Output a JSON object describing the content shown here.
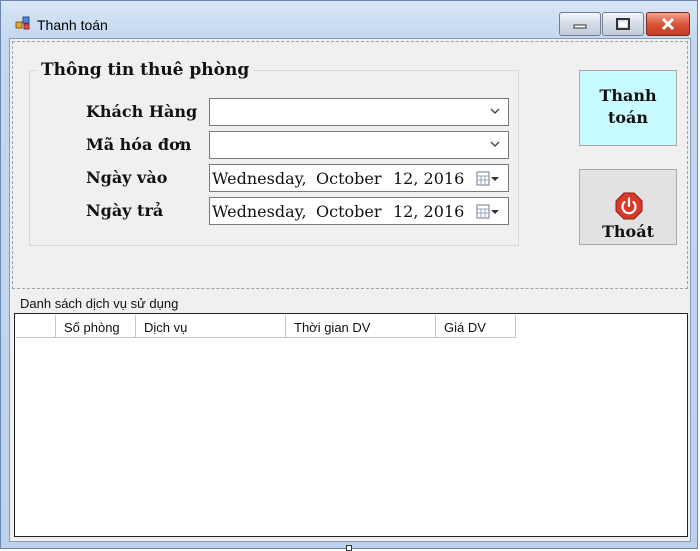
{
  "window": {
    "title": "Thanh toán",
    "accent": "#c43b22"
  },
  "group": {
    "title": "Thông tin thuê phòng",
    "fields": {
      "khach_hang": {
        "label": "Khách Hàng",
        "value": ""
      },
      "ma_hoa_don": {
        "label": "Mã hóa đơn",
        "value": ""
      },
      "ngay_vao": {
        "label": "Ngày vào",
        "weekday": "Wednesday,",
        "month": "October",
        "day": "12, 2016"
      },
      "ngay_tra": {
        "label": "Ngày trả",
        "weekday": "Wednesday,",
        "month": "October",
        "day": "12, 2016"
      }
    }
  },
  "buttons": {
    "pay": {
      "line1": "Thanh",
      "line2": "toán",
      "color": "#c8fbff"
    },
    "exit": {
      "label": "Thoát",
      "icon": "power-icon"
    }
  },
  "list": {
    "caption": "Danh sách dịch vụ sử dụng",
    "columns": [
      "",
      "Số phòng",
      "Dịch vụ",
      "Thời gian DV",
      "Giá DV"
    ],
    "rows": []
  }
}
